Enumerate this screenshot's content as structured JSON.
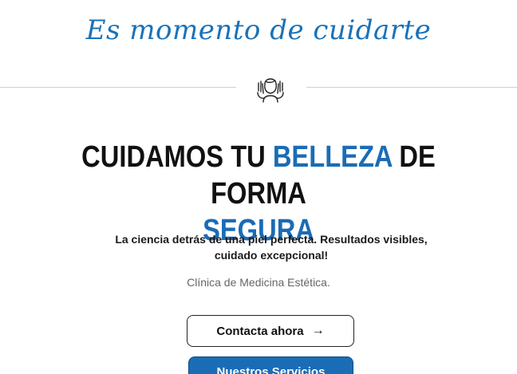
{
  "hero": {
    "script_title": "Es momento de cuidarte",
    "icon": "face-care-icon",
    "headline": {
      "part1": "CUIDAMOS TU ",
      "accent1": "BELLEZA",
      "part2": " DE FORMA",
      "accent2": "SEGURA"
    },
    "subtitle": "La ciencia detrás de una piel perfecta. Resultados visibles, cuidado excepcional!",
    "tagline": "Clínica de Medicina Estética.",
    "primary_button": {
      "label": "Contacta ahora",
      "icon": "arrow-right-icon"
    },
    "secondary_button": {
      "label": "Nuestros Servicios"
    }
  },
  "colors": {
    "accent": "#1a6cb5",
    "script": "#1a72b8",
    "text": "#111111"
  }
}
